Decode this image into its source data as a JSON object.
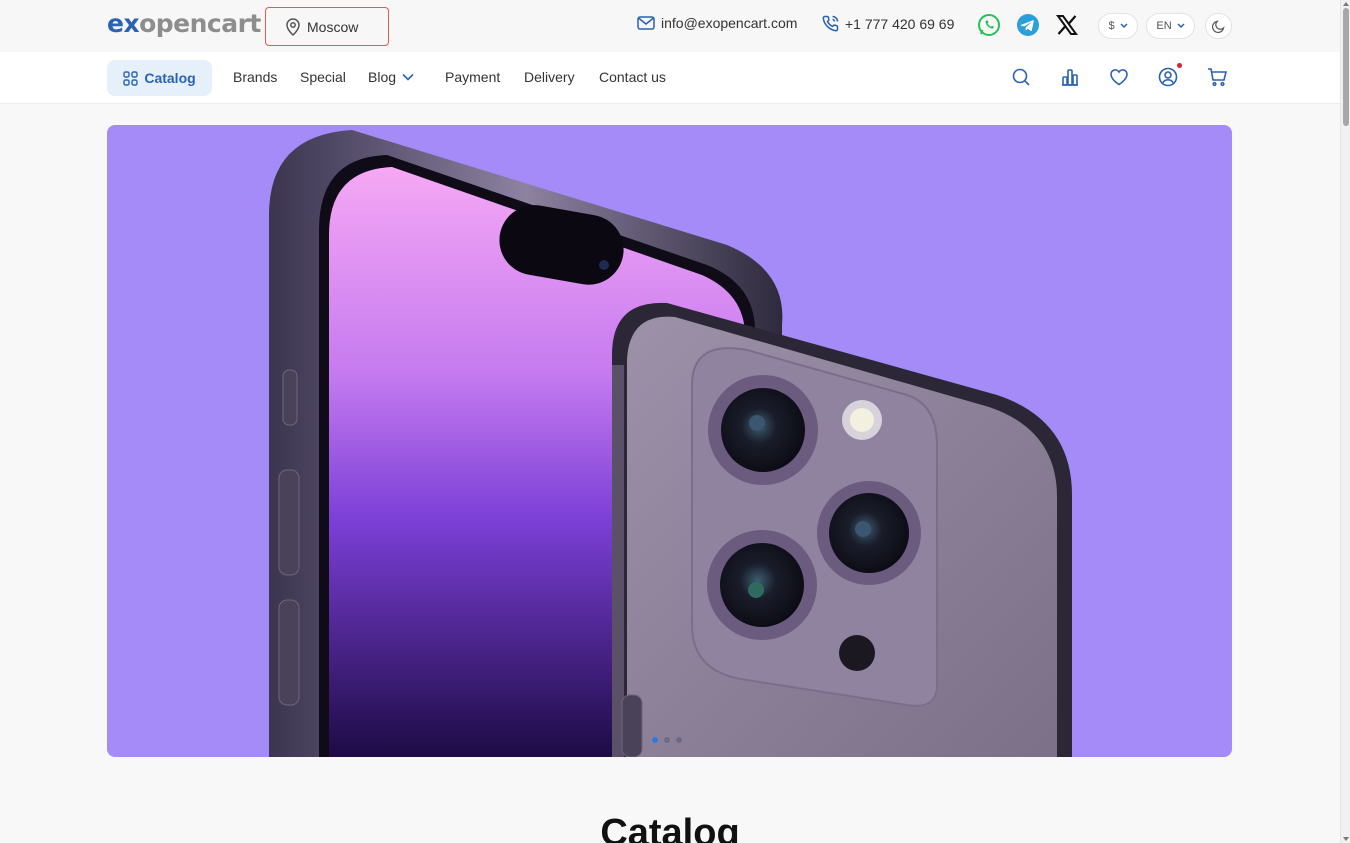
{
  "brand": {
    "logo_part1": "ex",
    "logo_part2": "opencart"
  },
  "header": {
    "city": "Moscow",
    "email": "info@exopencart.com",
    "phone": "+1 777 420 69 69",
    "currency": "$",
    "language": "EN"
  },
  "nav": {
    "catalog": "Catalog",
    "links": [
      "Brands",
      "Special",
      "Blog",
      "Payment",
      "Delivery",
      "Contact us"
    ]
  },
  "icons": {
    "city": "map-pin-icon",
    "email": "mail-icon",
    "phone": "phone-icon",
    "social": [
      "whatsapp-icon",
      "telegram-icon",
      "x-twitter-icon"
    ],
    "theme": "moon-icon",
    "actions": [
      "search-icon",
      "compare-icon",
      "heart-icon",
      "user-icon",
      "cart-icon"
    ]
  },
  "colors": {
    "accent": "#2a62b4",
    "hero_bg": "#a48bf8",
    "notify": "#d9242b",
    "city_border": "#e25b55"
  },
  "hero": {
    "slides": 3,
    "active_slide": 1
  },
  "section": {
    "title": "Catalog"
  }
}
